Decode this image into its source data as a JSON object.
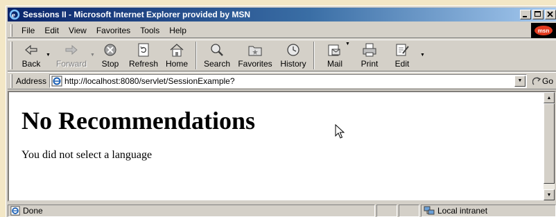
{
  "window": {
    "title": "Sessions II - Microsoft Internet Explorer provided by MSN"
  },
  "menu": {
    "items": [
      "File",
      "Edit",
      "View",
      "Favorites",
      "Tools",
      "Help"
    ],
    "brand": "msn"
  },
  "toolbar": {
    "back": "Back",
    "forward": "Forward",
    "stop": "Stop",
    "refresh": "Refresh",
    "home": "Home",
    "search": "Search",
    "favorites": "Favorites",
    "history": "History",
    "mail": "Mail",
    "print": "Print",
    "edit": "Edit"
  },
  "address": {
    "label": "Address",
    "url": "http://localhost:8080/servlet/SessionExample?",
    "go": "Go"
  },
  "page": {
    "heading": "No Recommendations",
    "message": "You did not select a language"
  },
  "status": {
    "text": "Done",
    "zone": "Local intranet"
  },
  "colors": {
    "titlebar_start": "#0a246a",
    "titlebar_end": "#a6caf0",
    "chrome": "#d4d0c8",
    "outer_background": "#f3e7c6"
  }
}
